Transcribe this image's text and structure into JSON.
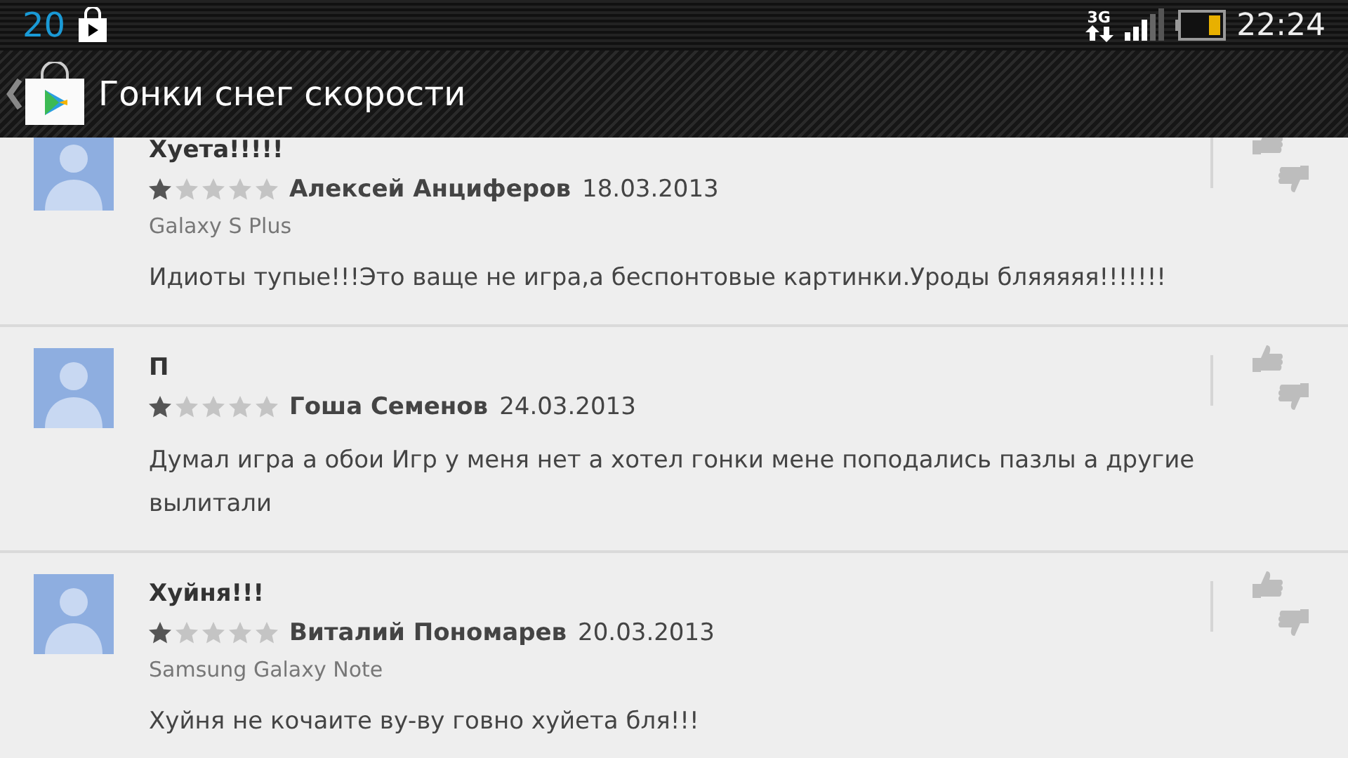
{
  "status_bar": {
    "notification_count": "20",
    "network": "3G",
    "time": "22:24"
  },
  "app_bar": {
    "title": "Гонки снег скорости"
  },
  "reviews": [
    {
      "title": "Хуета!!!!!",
      "stars": 1,
      "author": "Алексей Анциферов",
      "date": "18.03.2013",
      "device": "Galaxy S Plus",
      "text": "Идиоты тупые!!!Это ваще не игра,а беспонтовые картинки.Уроды бляяяяя!!!!!!!"
    },
    {
      "title": "П",
      "stars": 1,
      "author": "Гоша Семенов",
      "date": "24.03.2013",
      "text": "Думал игра а обои Игр у меня нет а хотел гонки мене поподались пазлы а другие вылитали"
    },
    {
      "title": "Хуйня!!!",
      "stars": 1,
      "author": "Виталий Пономарев",
      "date": "20.03.2013",
      "device": "Samsung Galaxy Note",
      "text": "Хуйня не кочаите ву-ву говно хуйета бля!!!"
    }
  ]
}
